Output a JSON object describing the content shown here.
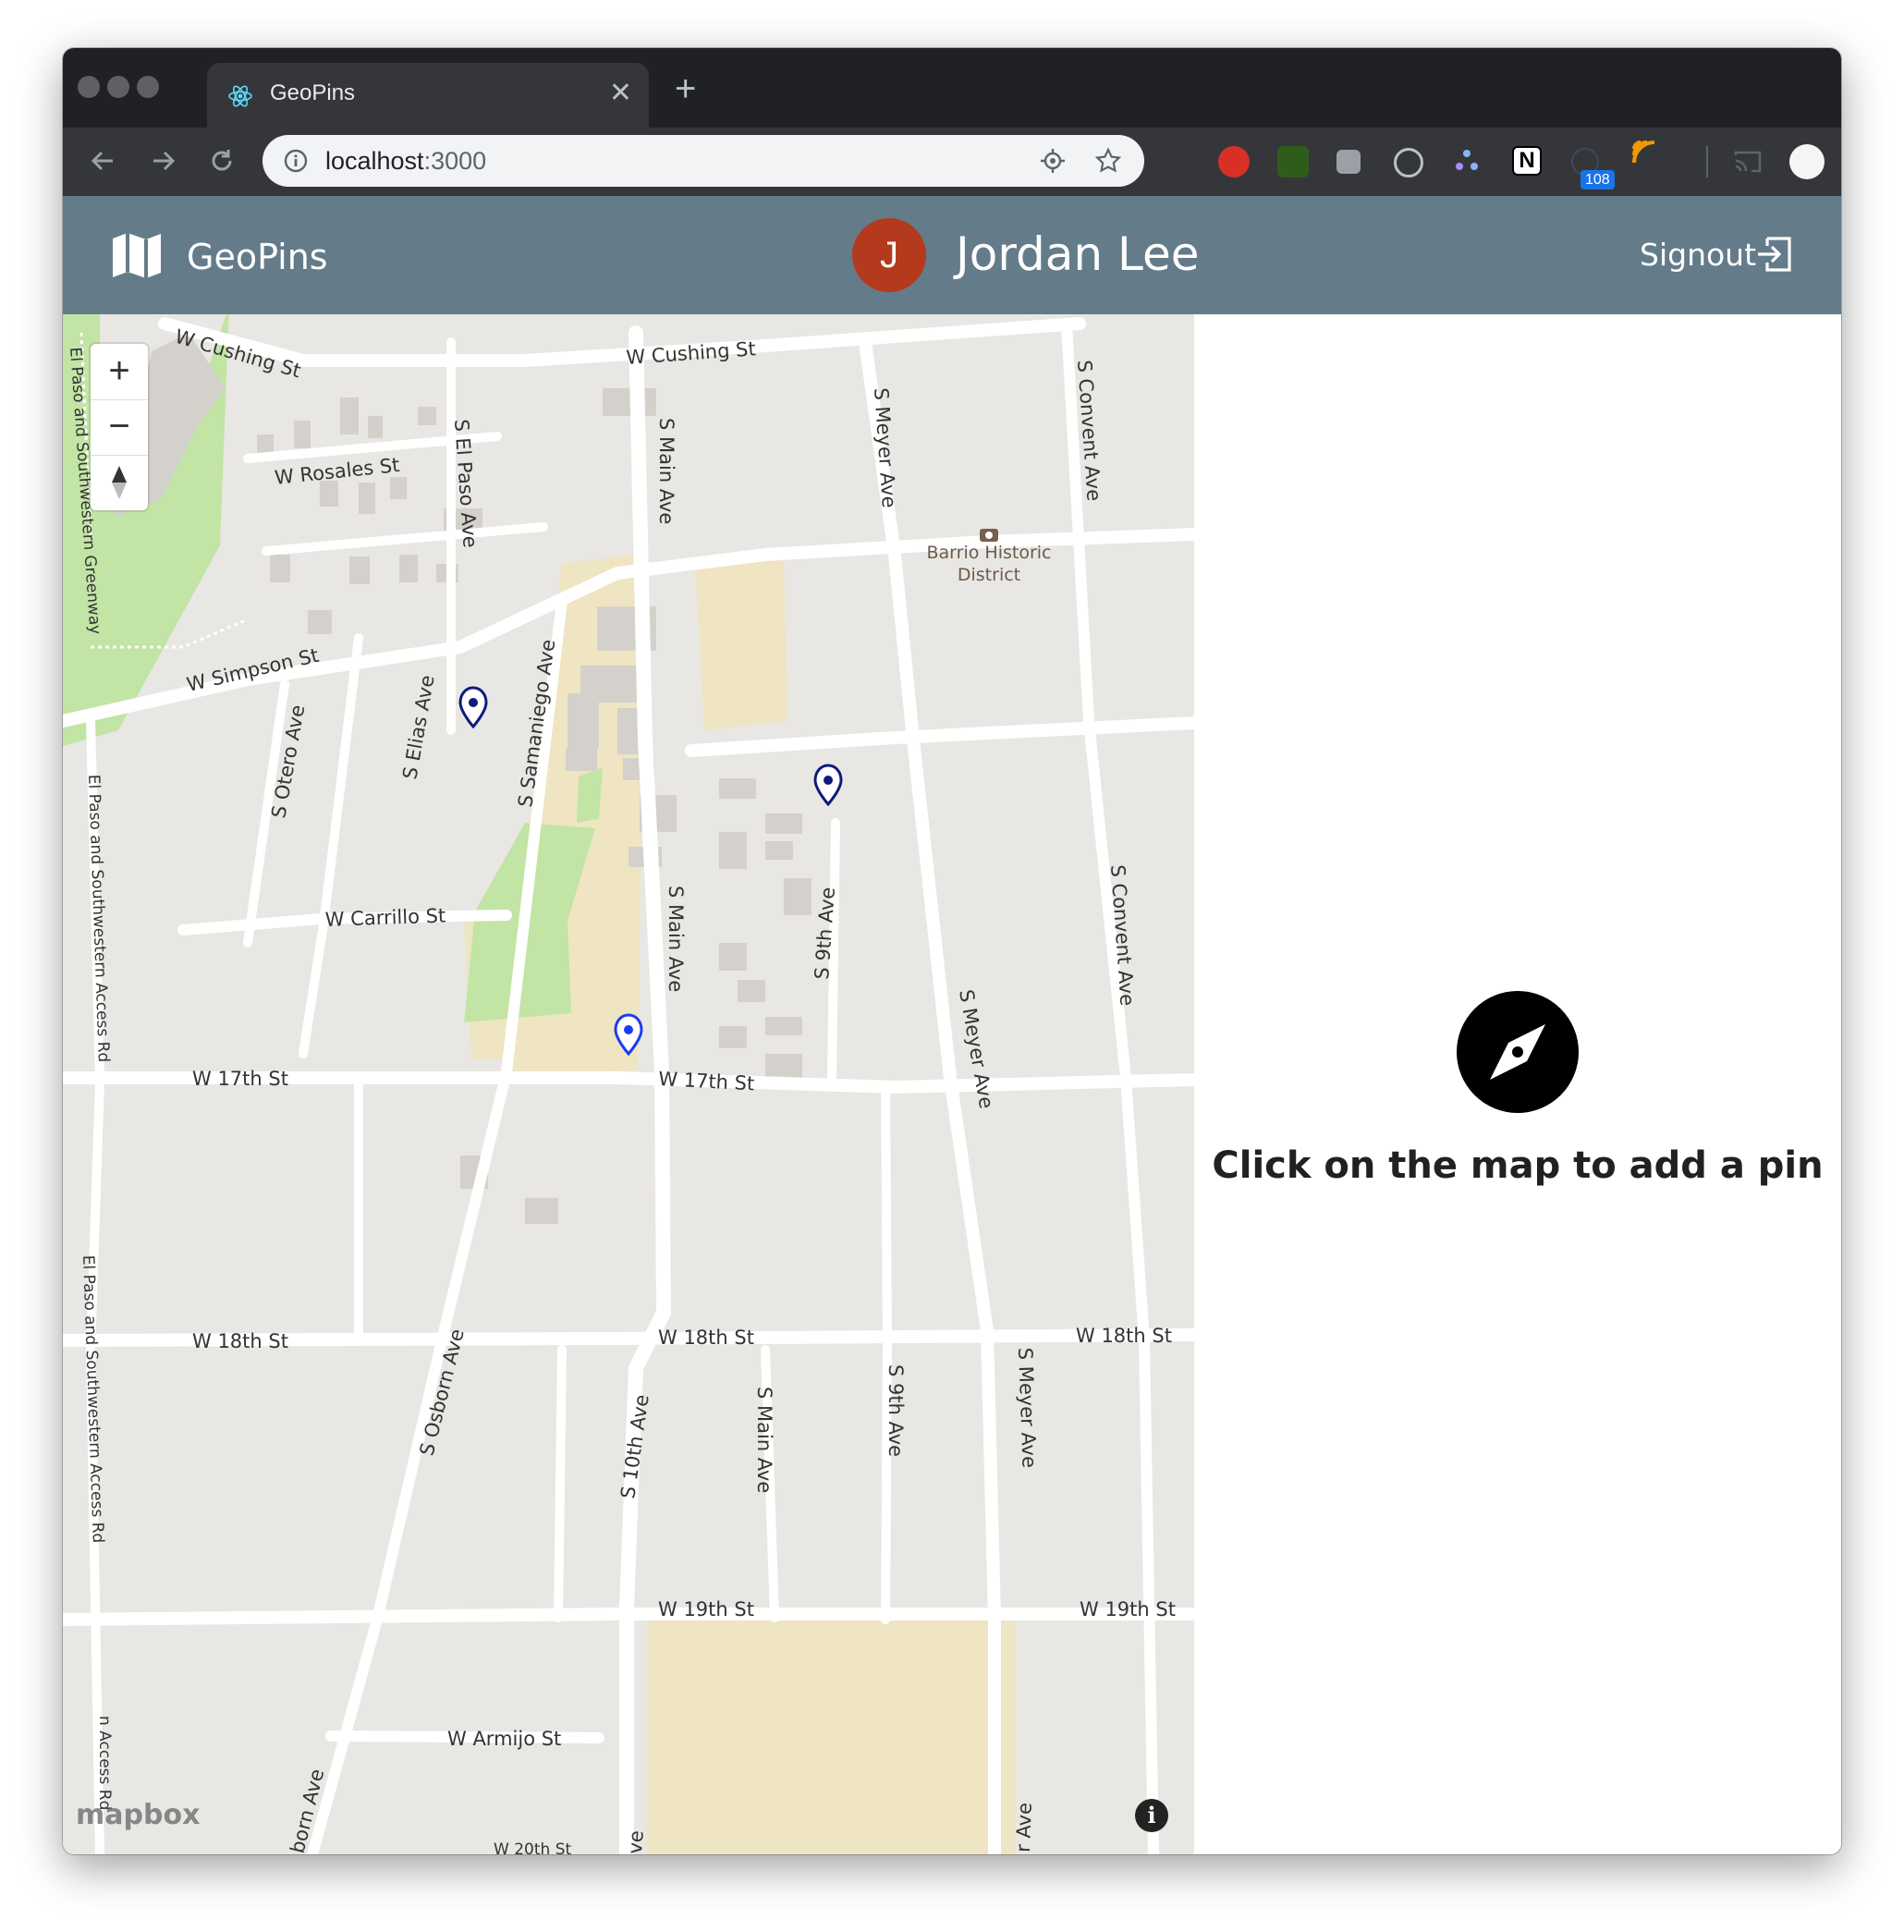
{
  "browser": {
    "tab_title": "GeoPins",
    "url_host": "localhost",
    "url_port": ":3000",
    "extension_badge": "108"
  },
  "header": {
    "brand": "GeoPins",
    "avatar_initial": "J",
    "user_name": "Jordan Lee",
    "signout_label": "Signout"
  },
  "map": {
    "zoom_in": "+",
    "zoom_out": "−",
    "attribution": "mapbox",
    "info": "i",
    "streets": {
      "w_cushing_1": "W Cushing St",
      "w_cushing_2": "W Cushing St",
      "w_rosales": "W Rosales St",
      "s_el_paso_ave": "S El Paso Ave",
      "s_main_ave_1": "S Main Ave",
      "s_main_ave_2": "S Main Ave",
      "s_main_ave_3": "S Main Ave",
      "s_meyer_ave_1": "S Meyer Ave",
      "s_meyer_ave_2": "S Meyer Ave",
      "s_meyer_ave_3": "S Meyer Ave",
      "s_convent_ave_1": "S Convent Ave",
      "s_convent_ave_2": "S Convent Ave",
      "barrio_1": "Barrio Historic",
      "barrio_2": "District",
      "w_simpson": "W Simpson St",
      "s_otero_ave": "S Otero Ave",
      "s_elias_ave": "S Elias Ave",
      "s_samaniego_ave": "S Samaniego Ave",
      "w_carrillo": "W Carrillo St",
      "s_9th_ave_1": "S 9th Ave",
      "s_9th_ave_2": "S 9th Ave",
      "w_17th_1": "W 17th St",
      "w_17th_2": "W 17th St",
      "w_18th_1": "W 18th St",
      "w_18th_2": "W 18th St",
      "w_18th_3": "W 18th St",
      "s_osborn_ave": "S Osborn Ave",
      "s_10th_ave": "S 10th Ave",
      "w_19th_1": "W 19th St",
      "w_19th_2": "W 19th St",
      "w_armijo": "W Armijo St",
      "greenway": "El Paso and Southwestern Greenway",
      "access_rd_1": "El Paso and Southwestern Access Rd",
      "access_rd_2": "El Paso and Southwestern Access Rd",
      "access_rd_3": "n Access Rd",
      "w_20th": "W 20th St",
      "osborn_cut": "born Ave",
      "ave_cut_1": "ve",
      "ave_cut_2": "r Ave"
    },
    "pins": [
      {
        "name": "pin-1",
        "color": "#0d1b7a"
      },
      {
        "name": "pin-2",
        "color": "#0d1b7a"
      },
      {
        "name": "pin-3",
        "color": "#1a3cf5"
      }
    ]
  },
  "panel": {
    "message": "Click on the map to add a pin"
  },
  "colors": {
    "appbar": "#647b8a",
    "avatar": "#b33a1d",
    "map_bg": "#e9e7e3",
    "park": "#c2e4a5",
    "school": "#efe5c2"
  }
}
